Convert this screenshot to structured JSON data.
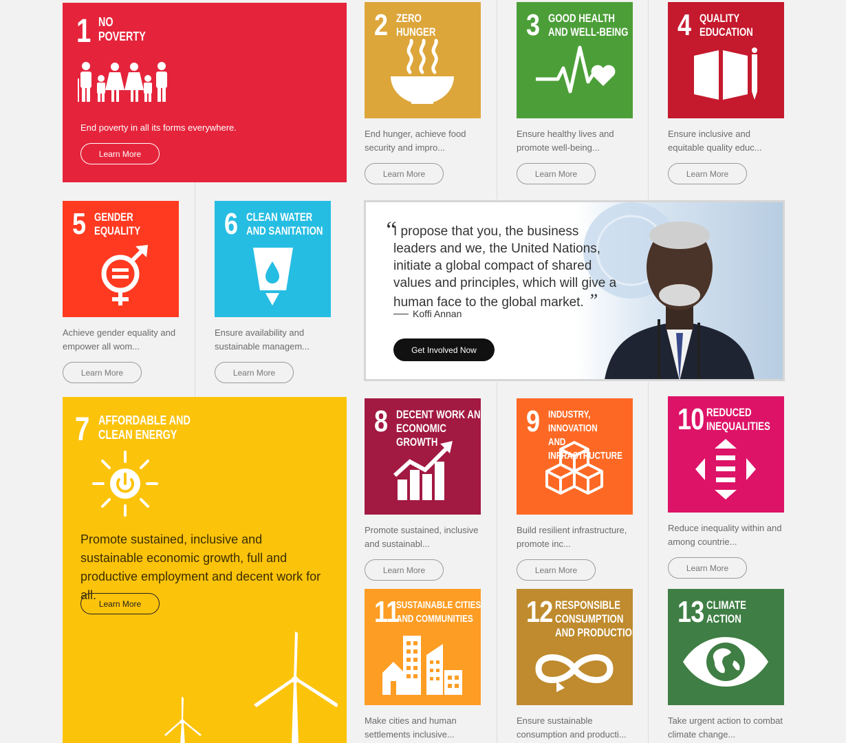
{
  "goals": [
    {
      "num": "1",
      "title": "NO\nPOVERTY",
      "desc": "End poverty in all its forms everywhere.",
      "button": "Learn More",
      "color": "#e5243b",
      "icon": "family-icon"
    },
    {
      "num": "2",
      "title": "ZERO\nHUNGER",
      "desc": "End hunger, achieve food security and impro...",
      "button": "Learn More",
      "color": "#dda63a",
      "icon": "bowl-icon"
    },
    {
      "num": "3",
      "title": "GOOD HEALTH\nAND WELL-BEING",
      "desc": "Ensure healthy lives and promote well-being...",
      "button": "Learn More",
      "color": "#4c9f38",
      "icon": "heartbeat-icon"
    },
    {
      "num": "4",
      "title": "QUALITY\nEDUCATION",
      "desc": "Ensure inclusive and equitable quality educ...",
      "button": "Learn More",
      "color": "#c5192d",
      "icon": "book-icon"
    },
    {
      "num": "5",
      "title": "GENDER\nEQUALITY",
      "desc": "Achieve gender equality and empower all wom...",
      "button": "Learn More",
      "color": "#ff3a21",
      "icon": "gender-equality-icon"
    },
    {
      "num": "6",
      "title": "CLEAN WATER\nAND SANITATION",
      "desc": "Ensure availability and sustainable managem...",
      "button": "Learn More",
      "color": "#26bde2",
      "icon": "water-glass-icon"
    },
    {
      "num": "7",
      "title": "AFFORDABLE AND\nCLEAN ENERGY",
      "desc": "Promote sustained, inclusive and sustainable economic growth, full and productive employment and decent work for all.",
      "button": "Learn More",
      "color": "#fcc30b",
      "icon": "sun-power-icon"
    },
    {
      "num": "8",
      "title": "DECENT WORK AND\nECONOMIC GROWTH",
      "desc": "Promote sustained, inclusive and sustainabl...",
      "button": "Learn More",
      "color": "#a21942",
      "icon": "growth-chart-icon"
    },
    {
      "num": "9",
      "title": "INDUSTRY, INNOVATION\nAND INFRASTRUCTURE",
      "desc": "Build resilient infrastructure, promote inc...",
      "button": "Learn More",
      "color": "#fd6925",
      "icon": "cubes-icon"
    },
    {
      "num": "10",
      "title": "REDUCED\nINEQUALITIES",
      "desc": "Reduce inequality within and among countrie...",
      "button": "Learn More",
      "color": "#dd1367",
      "icon": "equal-arrows-icon"
    },
    {
      "num": "11",
      "title": "SUSTAINABLE CITIES\nAND COMMUNITIES",
      "desc": "Make cities and human settlements inclusive...",
      "color": "#fd9d24",
      "icon": "city-icon"
    },
    {
      "num": "12",
      "title": "RESPONSIBLE\nCONSUMPTION\nAND PRODUCTION",
      "desc": "Ensure sustainable consumption and producti...",
      "color": "#bf8b2e",
      "icon": "infinity-icon"
    },
    {
      "num": "13",
      "title": "CLIMATE\nACTION",
      "desc": "Take urgent action to combat climate change...",
      "color": "#3f7e44",
      "icon": "eye-globe-icon"
    }
  ],
  "quote": {
    "text": "I propose that you, the business leaders and we, the United Nations, initiate a global compact of shared values and principles, which will give a human face to the global market.",
    "author": "Koffi Annan",
    "button": "Get Involved Now"
  }
}
